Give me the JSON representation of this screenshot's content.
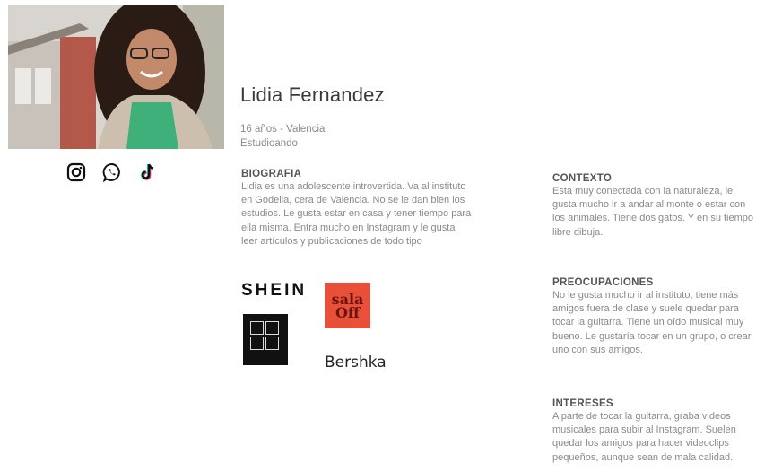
{
  "profile": {
    "name": "Lidia Fernandez",
    "age_city": "16 años - Valencia",
    "occupation": "Estudioando"
  },
  "social_icons": [
    "instagram-icon",
    "whatsapp-icon",
    "tiktok-icon"
  ],
  "sections": {
    "biografia": {
      "title": "BIOGRAFIA",
      "lines": [
        "Lidia es una adolescente introvertida. Va al instituto",
        "en Godella, cera de Valencia. No se le dan bien los",
        "estudios. Le gusta estar en casa y tener tiempo para",
        "ella misma. Entra mucho en Instagram y le gusta",
        "leer artículos y publicaciones de todo tipo"
      ]
    },
    "contexto": {
      "title": "CONTEXTO",
      "lines": [
        "Esta muy conectada con la naturaleza, le",
        "gusta mucho ir a andar al monte o estar con",
        "los animales. Tiene dos gatos. Y en su tiempo",
        "libre dibuja."
      ]
    },
    "preocupaciones": {
      "title": "PREOCUPACIONES",
      "lines": [
        "No le gusta mucho ir al instituto, tiene más",
        "amigos fuera de clase y suele quedar para",
        "tocar la guitarra. Tiene un oído musical muy",
        "bueno. Le gustaría tocar en un grupo, o crear",
        "uno con sus amigos."
      ]
    },
    "intereses": {
      "title": "INTERESES",
      "lines": [
        "A parte de tocar la guitarra, graba videos",
        "musicales para subir al Instagram. Suelen",
        "quedar los amigos para hacer videoclips",
        "pequeños, aunque sean de mala calidad."
      ]
    }
  },
  "brands": {
    "shein": "SHEIN",
    "sala_off_top": "sala",
    "sala_off_bottom": "Off",
    "bershka": "Bershka"
  },
  "colors": {
    "sala_off_bg": "#e8503a",
    "photo_shirt": "#3fb07a"
  }
}
